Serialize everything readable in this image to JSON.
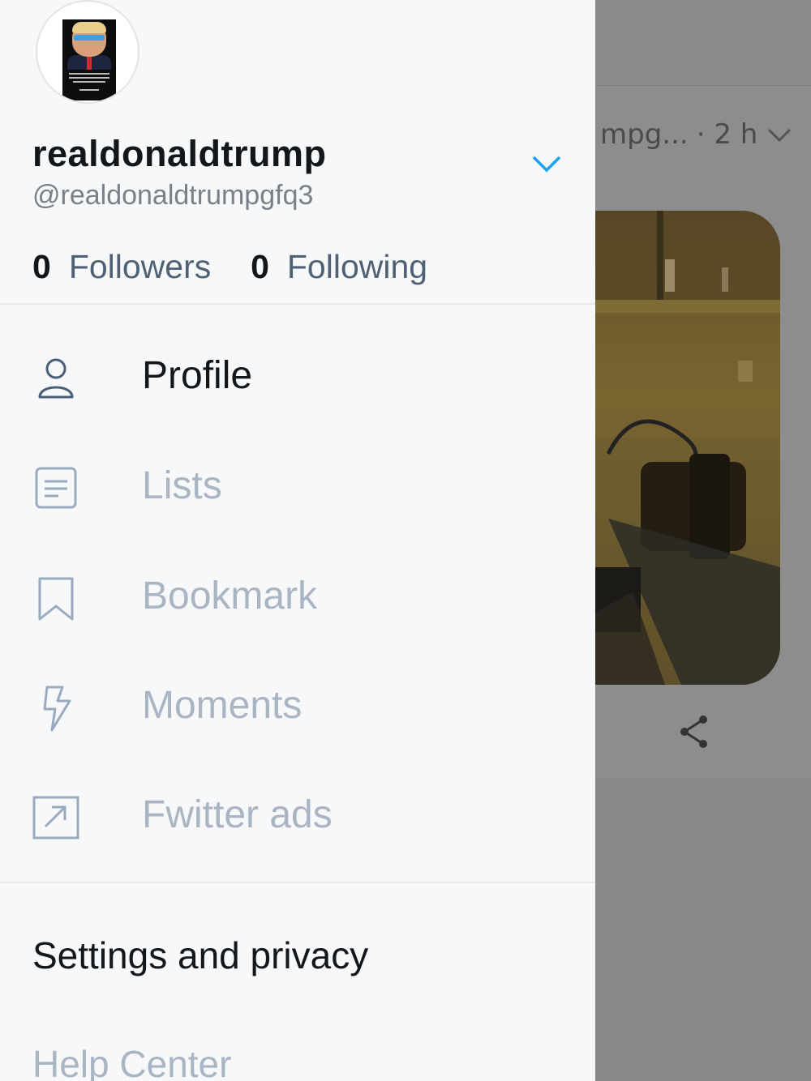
{
  "background": {
    "tweet_handle_fragment": "mpg...",
    "tweet_time": "· 2 h"
  },
  "drawer": {
    "username": "realdonaldtrump",
    "handle": "@realdonaldtrumpgfq3",
    "followers_count": "0",
    "followers_label": "Followers",
    "following_count": "0",
    "following_label": "Following",
    "menu": [
      {
        "label": "Profile",
        "icon": "person-icon"
      },
      {
        "label": "Lists",
        "icon": "list-icon"
      },
      {
        "label": "Bookmark",
        "icon": "bookmark-icon"
      },
      {
        "label": "Moments",
        "icon": "lightning-icon"
      },
      {
        "label": "Fwitter ads",
        "icon": "external-link-icon"
      }
    ],
    "settings_label": "Settings and privacy",
    "help_label": "Help Center"
  },
  "colors": {
    "accent": "#1da1f2",
    "text_primary": "#14171a",
    "text_muted": "#a9b5c3",
    "drawer_bg": "#f7f8fa"
  }
}
